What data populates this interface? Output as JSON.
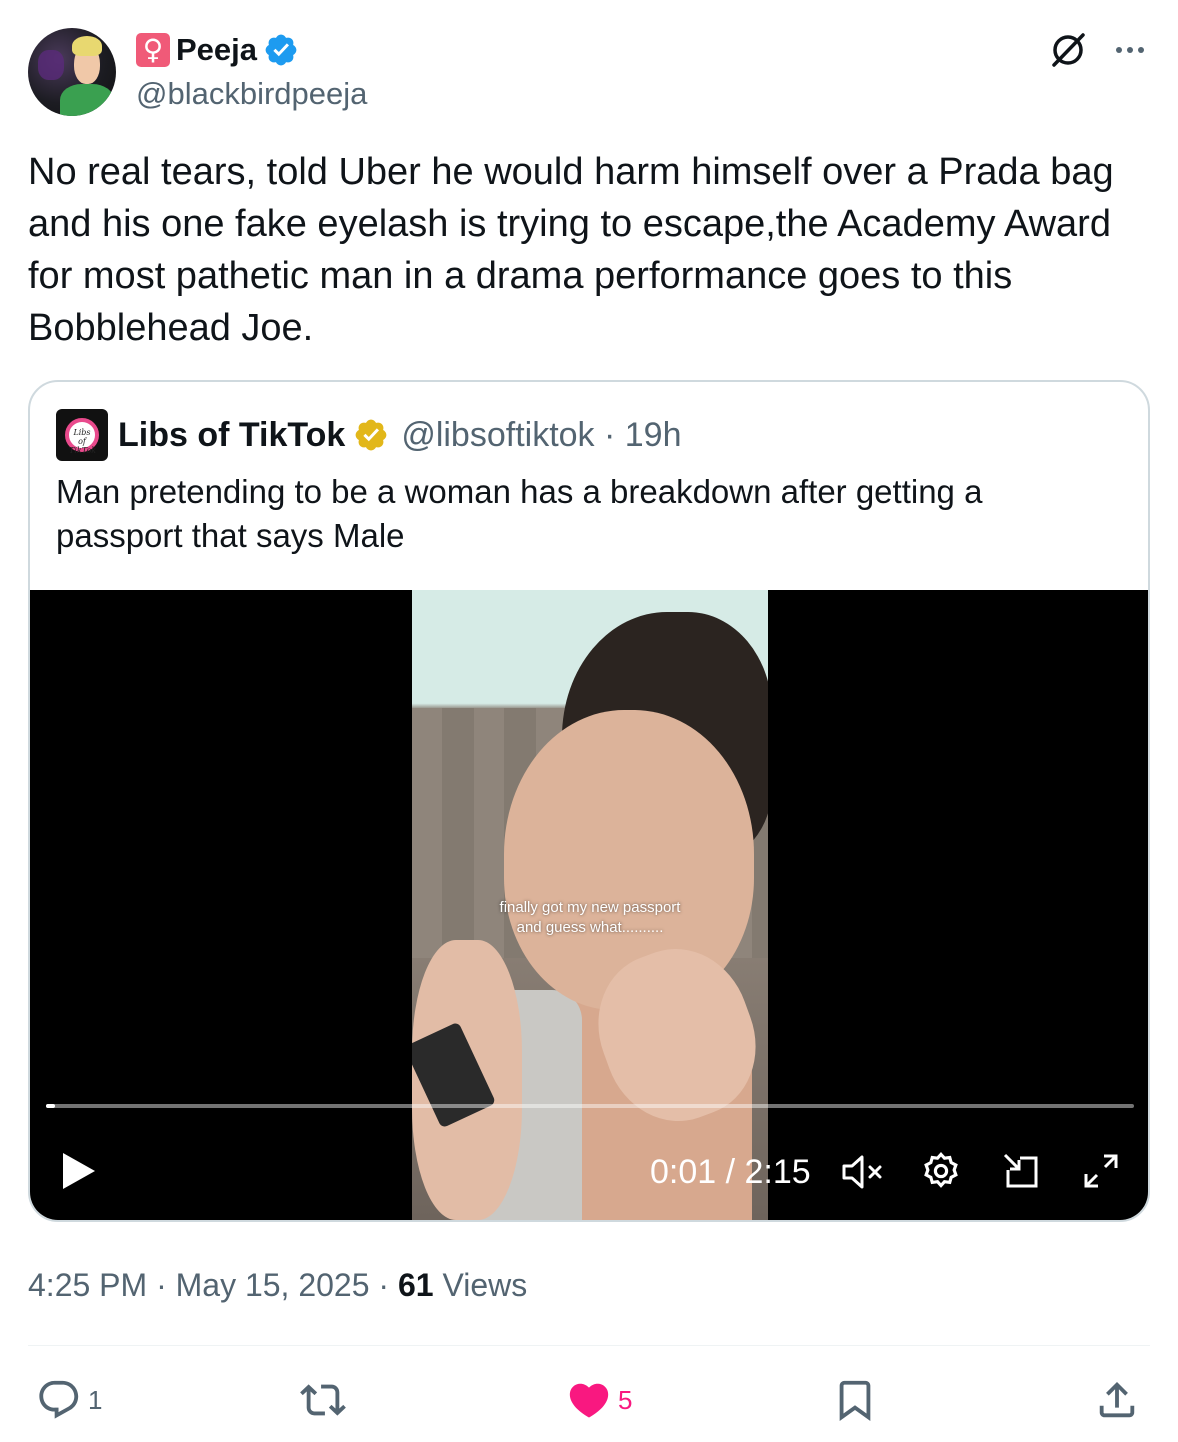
{
  "author": {
    "flag_glyph": "♀",
    "display_name": "Peeja",
    "handle": "@blackbirdpeeja"
  },
  "tweet_text": "No real tears, told Uber he would harm himself over a Prada bag and his one fake eyelash is trying to escape,the Academy Award for most pathetic man in a drama performance goes to this Bobblehead Joe.",
  "quoted": {
    "avatar_text": "Libs of TikTok",
    "display_name": "Libs of TikTok",
    "handle_time": "@libsoftiktok · 19h",
    "text": "Man pretending to be a woman has a breakdown after getting a passport that says Male",
    "video": {
      "caption_line1": "finally got my new passport",
      "caption_line2": "and guess what..........",
      "time": "0:01 / 2:15",
      "progress": 0.008
    }
  },
  "meta": {
    "time_date": "4:25 PM · May 15, 2025 · ",
    "views_count": "61",
    "views_label": " Views"
  },
  "actions": {
    "replies": "1",
    "likes": "5"
  },
  "colors": {
    "text": "#0f1419",
    "secondary": "#536471",
    "verified_blue": "#1d9bf0",
    "verified_gold": "#e2b719",
    "like_pink": "#f91880",
    "border": "#cfd9de"
  },
  "icons": [
    "verified-badge-icon",
    "grok-icon",
    "more-icon",
    "gold-verified-icon",
    "play-icon",
    "volume-muted-icon",
    "settings-icon",
    "pip-icon",
    "fullscreen-icon",
    "reply-icon",
    "retweet-icon",
    "like-icon",
    "bookmark-icon",
    "share-icon"
  ]
}
